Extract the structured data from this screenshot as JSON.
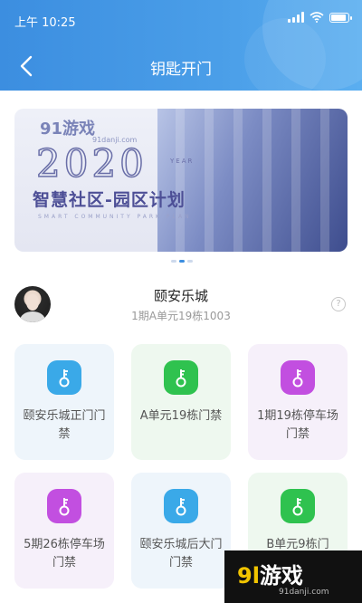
{
  "status_bar": {
    "time": "上午 10:25"
  },
  "nav": {
    "title": "钥匙开门"
  },
  "banner": {
    "watermark_logo": "91游戏",
    "watermark_url": "91danji.com",
    "year": "2020",
    "year_sub": "YEAR",
    "headline": "智慧社区-园区计划",
    "headline_sub": "SMART COMMUNITY PARK PLAN"
  },
  "carousel": {
    "count": 3,
    "active_index": 1
  },
  "community": {
    "name": "颐安乐城",
    "unit": "1期A单元19栋1003",
    "help_symbol": "?"
  },
  "doors": [
    {
      "label": "颐安乐城正门门禁",
      "card_bg": "#eef5fb",
      "icon_bg": "#3aa9e8"
    },
    {
      "label": "A单元19栋门禁",
      "card_bg": "#eef8ef",
      "icon_bg": "#2fc24f"
    },
    {
      "label": "1期19栋停车场门禁",
      "card_bg": "#f6f0fa",
      "icon_bg": "#c24fe0"
    },
    {
      "label": "5期26栋停车场门禁",
      "card_bg": "#f6f0fa",
      "icon_bg": "#c24fe0"
    },
    {
      "label": "颐安乐城后大门门禁",
      "card_bg": "#eef5fb",
      "icon_bg": "#3aa9e8"
    },
    {
      "label": "B单元9栋门",
      "card_bg": "#eef8ef",
      "icon_bg": "#2fc24f"
    }
  ],
  "watermark": {
    "brand_a": "9l",
    "brand_b": "游戏",
    "site": "91danji.com"
  },
  "colors": {
    "header": "#3c8ee0",
    "accent_blue": "#3aa9e8",
    "accent_green": "#2fc24f",
    "accent_purple": "#c24fe0"
  }
}
